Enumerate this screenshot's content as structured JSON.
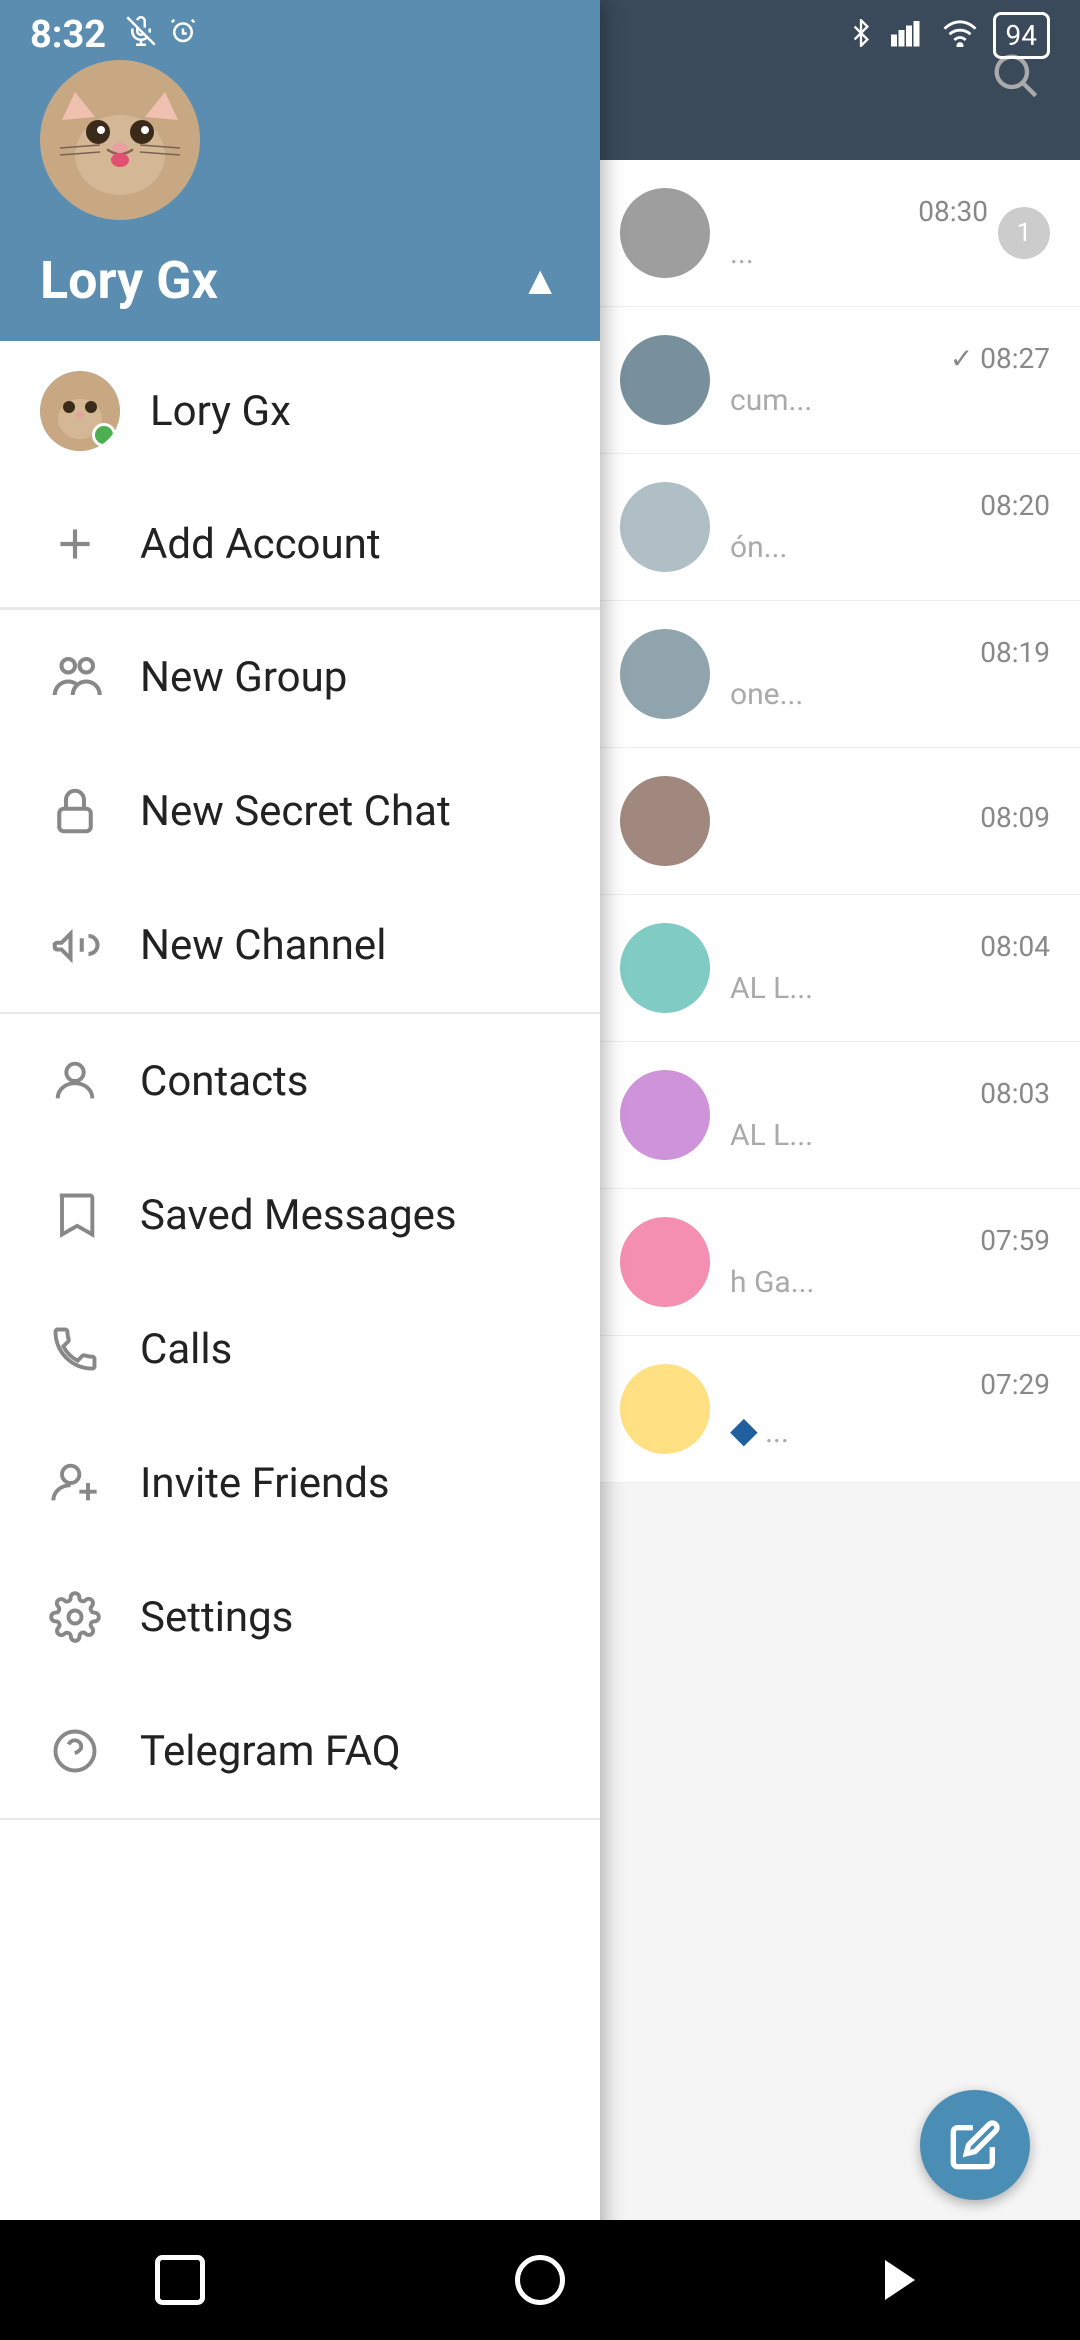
{
  "statusBar": {
    "time": "8:32",
    "battery": "94",
    "icons": [
      "mute",
      "alarm",
      "bluetooth",
      "signal",
      "wifi"
    ]
  },
  "drawer": {
    "header": {
      "userName": "Lory Gx",
      "arrowLabel": "▲"
    },
    "account": {
      "name": "Lory Gx",
      "statusDot": "online"
    },
    "addAccount": {
      "label": "Add Account",
      "icon": "plus"
    },
    "menuGroups": [
      {
        "items": [
          {
            "id": "new-group",
            "label": "New Group",
            "icon": "group"
          },
          {
            "id": "new-secret-chat",
            "label": "New Secret Chat",
            "icon": "lock"
          },
          {
            "id": "new-channel",
            "label": "New Channel",
            "icon": "megaphone"
          }
        ]
      },
      {
        "items": [
          {
            "id": "contacts",
            "label": "Contacts",
            "icon": "person"
          },
          {
            "id": "saved-messages",
            "label": "Saved Messages",
            "icon": "bookmark"
          },
          {
            "id": "calls",
            "label": "Calls",
            "icon": "phone"
          },
          {
            "id": "invite-friends",
            "label": "Invite Friends",
            "icon": "person-add"
          },
          {
            "id": "settings",
            "label": "Settings",
            "icon": "gear"
          },
          {
            "id": "telegram-faq",
            "label": "Telegram FAQ",
            "icon": "question"
          }
        ]
      }
    ]
  },
  "backgroundChat": {
    "items": [
      {
        "time": "08:30",
        "preview": "...",
        "badge": "1"
      },
      {
        "time": "08:27",
        "preview": "cum...",
        "check": true
      },
      {
        "time": "08:20",
        "preview": "ón..."
      },
      {
        "time": "08:19",
        "preview": "one..."
      },
      {
        "time": "08:09",
        "preview": ""
      },
      {
        "time": "08:04",
        "preview": "AL L..."
      },
      {
        "time": "08:03",
        "preview": "AL L..."
      },
      {
        "time": "07:59",
        "preview": "h Ga..."
      },
      {
        "time": "07:29",
        "preview": "...",
        "diamond": true
      }
    ]
  },
  "fab": {
    "icon": "pencil"
  },
  "bottomNav": {
    "items": [
      "square",
      "circle",
      "triangle-left"
    ]
  }
}
